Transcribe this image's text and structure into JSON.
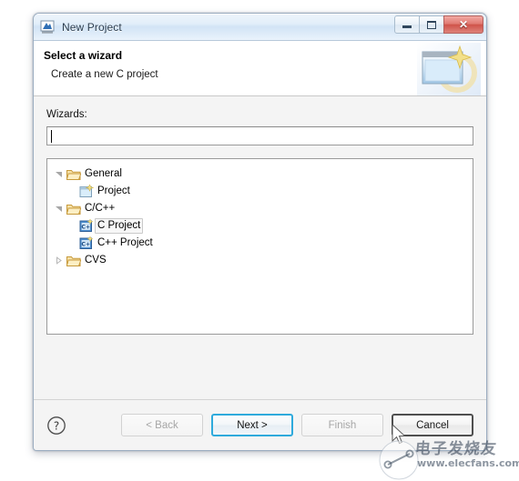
{
  "window": {
    "title": "New Project",
    "app_icon": "eclipse-icon",
    "controls": {
      "minimize_label": "Minimize",
      "maximize_label": "Maximize",
      "close_label": "Close"
    }
  },
  "header": {
    "title": "Select a wizard",
    "subtitle": "Create a new C project",
    "banner_icon": "new-wizard-banner-icon"
  },
  "form": {
    "wizards_label": "Wizards:",
    "filter": {
      "value": "",
      "placeholder": ""
    }
  },
  "tree": {
    "nodes": [
      {
        "label": "General",
        "depth": 0,
        "expander": "expanded",
        "icon": "open-folder-icon",
        "selected": false
      },
      {
        "label": "Project",
        "depth": 1,
        "expander": "none",
        "icon": "project-icon",
        "selected": false
      },
      {
        "label": "C/C++",
        "depth": 0,
        "expander": "expanded",
        "icon": "open-folder-icon",
        "selected": false
      },
      {
        "label": "C Project",
        "depth": 1,
        "expander": "none",
        "icon": "c-project-icon",
        "selected": true
      },
      {
        "label": "C++ Project",
        "depth": 1,
        "expander": "none",
        "icon": "cpp-project-icon",
        "selected": false
      },
      {
        "label": "CVS",
        "depth": 0,
        "expander": "collapsed",
        "icon": "open-folder-icon",
        "selected": false
      }
    ]
  },
  "buttons": {
    "help": "help-icon",
    "back": {
      "label": "< Back",
      "state": "disabled"
    },
    "next": {
      "label": "Next >",
      "state": "default"
    },
    "finish": {
      "label": "Finish",
      "state": "disabled"
    },
    "cancel": {
      "label": "Cancel",
      "state": "hover"
    }
  },
  "watermark": {
    "text_cn": "电子发烧友",
    "url": "www.elecfans.com"
  },
  "colors": {
    "accent_blue": "#2eaadc",
    "title_bar": "#d2e4f6",
    "close_red": "#cf5349",
    "folder_gold": "#e8b659",
    "tree_bg": "#ffffff",
    "dialog_bg": "#f4f4f4"
  }
}
